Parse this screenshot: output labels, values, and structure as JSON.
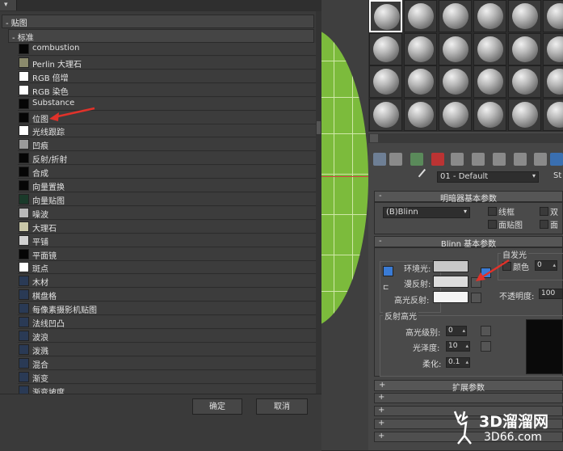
{
  "browser": {
    "top_dropdown": "▾",
    "maps_group": "- 贴图",
    "standard_group": "- 标准",
    "items": [
      {
        "label": "combustion",
        "swatch": "#050505"
      },
      {
        "label": "Perlin 大理石",
        "swatch": "#8b8a6c"
      },
      {
        "label": "RGB 倍增",
        "swatch": "#ffffff"
      },
      {
        "label": "RGB 染色",
        "swatch": "#ffffff"
      },
      {
        "label": "Substance",
        "swatch": "#050505"
      },
      {
        "label": "位图",
        "swatch": "#050505"
      },
      {
        "label": "光线跟踪",
        "swatch": "#ffffff"
      },
      {
        "label": "凹痕",
        "swatch": "#9a9a9a"
      },
      {
        "label": "反射/折射",
        "swatch": "#050505"
      },
      {
        "label": "合成",
        "swatch": "#050505"
      },
      {
        "label": "向量置换",
        "swatch": "#050505"
      },
      {
        "label": "向量贴图",
        "swatch": "#1a3a2a"
      },
      {
        "label": "噪波",
        "swatch": "#b8b8b8"
      },
      {
        "label": "大理石",
        "swatch": "#c9c7a8"
      },
      {
        "label": "平铺",
        "swatch": "#d0d0d0"
      },
      {
        "label": "平面镜",
        "swatch": "#050505"
      },
      {
        "label": "斑点",
        "swatch": "#ffffff"
      },
      {
        "label": "木材",
        "swatch": "#2a3a55"
      },
      {
        "label": "棋盘格",
        "swatch": "#2a3a55"
      },
      {
        "label": "每像素摄影机贴图",
        "swatch": "#2a3a55"
      },
      {
        "label": "法线凹凸",
        "swatch": "#2a3a55"
      },
      {
        "label": "波浪",
        "swatch": "#2a3a55"
      },
      {
        "label": "泼溅",
        "swatch": "#2a3a55"
      },
      {
        "label": "混合",
        "swatch": "#2a3a55"
      },
      {
        "label": "渐变",
        "swatch": "#2a3a55"
      },
      {
        "label": "渐变坡度",
        "swatch": "#2a3a55"
      }
    ],
    "ok_label": "确定",
    "cancel_label": "取消"
  },
  "material_editor": {
    "material_name": "01 - Default",
    "type_label": "St",
    "shader_rollout": {
      "title": "明暗器基本参数",
      "shader": "(B)Blinn",
      "wire": "线框",
      "two_sided": "双",
      "face_map": "面贴图",
      "faceted": "面"
    },
    "blinn_rollout": {
      "title": "Blinn 基本参数",
      "self_illum_group": "自发光",
      "color_label": "颜色",
      "self_illum_value": "0",
      "ambient": "环境光:",
      "diffuse": "漫反射:",
      "specular": "高光反射:",
      "opacity_label": "不透明度:",
      "opacity_value": "100",
      "spec_highlights_group": "反射高光",
      "spec_level": "高光级别:",
      "spec_level_value": "0",
      "glossiness": "光泽度:",
      "glossiness_value": "10",
      "soften": "柔化:",
      "soften_value": "0.1"
    },
    "extended_rollout": "扩展参数",
    "colors": {
      "ambient": "#c8c8c8",
      "diffuse": "#dcdcdc",
      "specular": "#f4f4f4"
    }
  },
  "watermark": {
    "brand": "3D溜溜网",
    "url": "3D66.com"
  }
}
